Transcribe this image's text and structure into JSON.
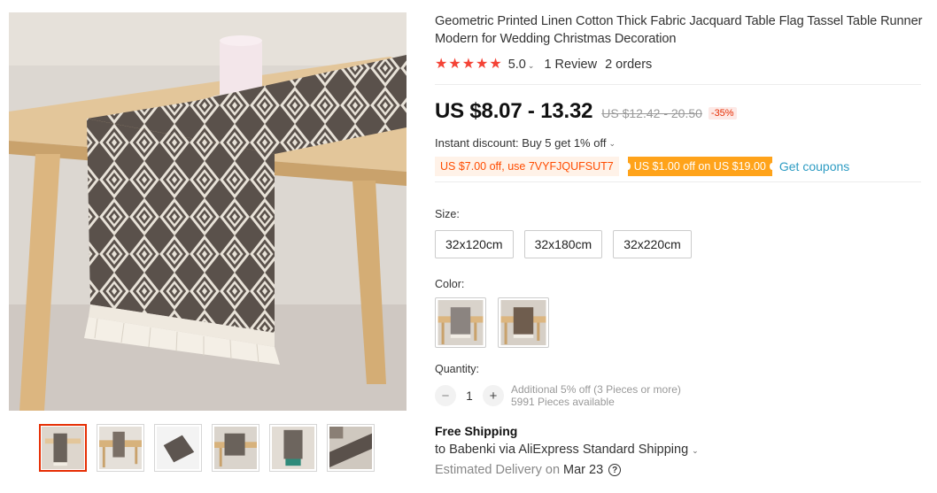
{
  "product": {
    "title": "Geometric Printed Linen Cotton Thick Fabric Jacquard Table Flag Tassel Table Runner Modern for Wedding Christmas Decoration",
    "rating": "5.0",
    "reviews": "1 Review",
    "orders": "2 orders",
    "star_color": "#f44336"
  },
  "price": {
    "current": "US $8.07 - 13.32",
    "original": "US $12.42 - 20.50",
    "discount": "-35%"
  },
  "instant_discount": "Instant discount: Buy 5 get 1% off",
  "coupons": {
    "code_coupon": "US $7.00 off, use 7VYFJQUFSUT7",
    "store_coupon": "US $1.00 off on US $19.00",
    "get_label": "Get coupons"
  },
  "size": {
    "label": "Size:",
    "options": [
      "32x120cm",
      "32x180cm",
      "32x220cm"
    ]
  },
  "color": {
    "label": "Color:"
  },
  "quantity": {
    "label": "Quantity:",
    "minus": "−",
    "value": "1",
    "plus": "+",
    "note_line1": "Additional 5% off (3 Pieces or more)",
    "note_line2": "5991 Pieces available"
  },
  "shipping": {
    "title": "Free Shipping",
    "via": "to Babenki via AliExpress Standard Shipping",
    "estimated_label": "Estimated Delivery on",
    "date": "Mar 23",
    "help": "?"
  },
  "icons": {
    "chevron": "chevron-down-icon",
    "help": "question-circle-icon"
  },
  "colors": {
    "accent": "#e62e04",
    "coupon_orange": "#ffa31a",
    "link": "#2e9cc3"
  }
}
